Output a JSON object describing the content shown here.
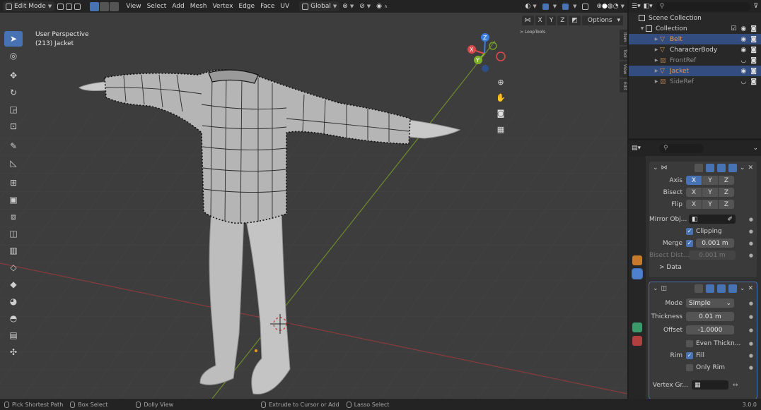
{
  "header": {
    "mode": "Edit Mode",
    "menus": [
      "View",
      "Select",
      "Add",
      "Mesh",
      "Vertex",
      "Edge",
      "Face",
      "UV"
    ],
    "transform_orientation": "Global"
  },
  "viewport": {
    "perspective": "User Perspective",
    "object": "(213) Jacket",
    "axis_x": "X",
    "axis_y": "Y",
    "axis_z": "Z",
    "options": "Options",
    "loop_tools": "> LoopTools",
    "side_tabs": [
      "Item",
      "Tool",
      "View",
      "Edit"
    ],
    "mirror_axes": [
      "X",
      "Y",
      "Z"
    ]
  },
  "outliner": {
    "scene_collection": "Scene Collection",
    "collection": "Collection",
    "items": [
      {
        "name": "Belt",
        "selected": true,
        "active": false,
        "dim": false
      },
      {
        "name": "CharacterBody",
        "selected": false,
        "active": false,
        "dim": false
      },
      {
        "name": "FrontRef",
        "selected": false,
        "active": false,
        "dim": true
      },
      {
        "name": "Jacket",
        "selected": true,
        "active": true,
        "dim": false
      },
      {
        "name": "SideRef",
        "selected": false,
        "active": false,
        "dim": true
      }
    ]
  },
  "mirror": {
    "axis_label": "Axis",
    "bisect_label": "Bisect",
    "flip_label": "Flip",
    "x": "X",
    "y": "Y",
    "z": "Z",
    "mirror_object_label": "Mirror Obj...",
    "clipping_label": "Clipping",
    "merge_label": "Merge",
    "merge_value": "0.001 m",
    "bisect_dist_label": "Bisect Dist...",
    "bisect_dist_value": "0.001 m",
    "data_label": "> Data"
  },
  "solidify": {
    "mode_label": "Mode",
    "mode_value": "Simple",
    "thickness_label": "Thickness",
    "thickness_value": "0.01 m",
    "offset_label": "Offset",
    "offset_value": "-1.0000",
    "even_thickness_label": "Even Thickn...",
    "rim_label": "Rim",
    "fill_label": "Fill",
    "only_rim_label": "Only Rim",
    "vertex_group_label": "Vertex Gr..."
  },
  "status": {
    "pick": "Pick Shortest Path",
    "box": "Box Select",
    "dolly": "Dolly View",
    "extrude": "Extrude to Cursor or Add",
    "lasso": "Lasso Select",
    "version": "3.0.0"
  },
  "colors": {
    "accent": "#4772b3",
    "selected_row": "#334d80",
    "active_name": "#e39b4a",
    "viewport_bg": "#3d3d3d"
  }
}
